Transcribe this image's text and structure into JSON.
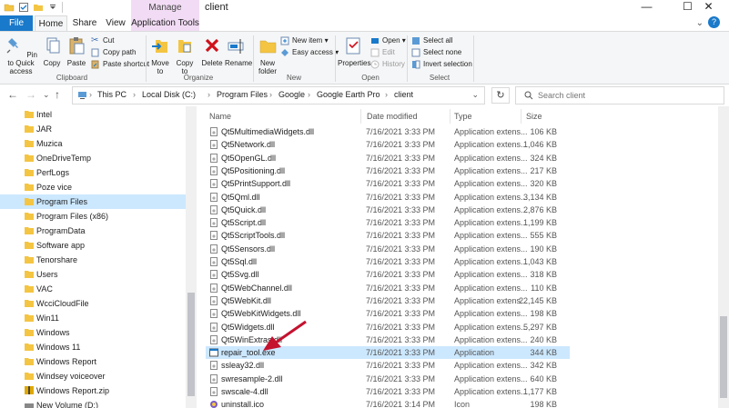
{
  "window": {
    "title": "client",
    "manage_label": "Manage",
    "minimize_glyph": "—",
    "maximize_glyph": "☐",
    "close_glyph": "✕"
  },
  "tabs": {
    "file": "File",
    "home": "Home",
    "share": "Share",
    "view": "View",
    "app_tools": "Application Tools"
  },
  "ribbon": {
    "clipboard": {
      "group": "Clipboard",
      "pin": "Pin to Quick access",
      "copy": "Copy",
      "paste": "Paste",
      "cut": "Cut",
      "copy_path": "Copy path",
      "paste_shortcut": "Paste shortcut"
    },
    "organize": {
      "group": "Organize",
      "move_to": "Move to",
      "copy_to": "Copy to",
      "delete": "Delete",
      "rename": "Rename"
    },
    "new": {
      "group": "New",
      "new_folder": "New folder",
      "new_item": "New item",
      "easy_access": "Easy access"
    },
    "open": {
      "group": "Open",
      "properties": "Properties",
      "open": "Open",
      "edit": "Edit",
      "history": "History"
    },
    "select": {
      "group": "Select",
      "select_all": "Select all",
      "select_none": "Select none",
      "invert": "Invert selection"
    }
  },
  "address": {
    "crumbs": [
      "This PC",
      "Local Disk (C:)",
      "Program Files",
      "Google",
      "Google Earth Pro",
      "client"
    ],
    "separator": "›",
    "search_placeholder": "Search client"
  },
  "nav": {
    "items": [
      {
        "label": "Intel",
        "selected": false
      },
      {
        "label": "JAR",
        "selected": false
      },
      {
        "label": "Muzica",
        "selected": false
      },
      {
        "label": "OneDriveTemp",
        "selected": false
      },
      {
        "label": "PerfLogs",
        "selected": false
      },
      {
        "label": "Poze vice",
        "selected": false
      },
      {
        "label": "Program Files",
        "selected": true
      },
      {
        "label": "Program Files (x86)",
        "selected": false
      },
      {
        "label": "ProgramData",
        "selected": false
      },
      {
        "label": "Software app",
        "selected": false
      },
      {
        "label": "Tenorshare",
        "selected": false
      },
      {
        "label": "Users",
        "selected": false
      },
      {
        "label": "VAC",
        "selected": false
      },
      {
        "label": "WcciCloudFile",
        "selected": false
      },
      {
        "label": "Win11",
        "selected": false
      },
      {
        "label": "Windows",
        "selected": false
      },
      {
        "label": "Windows 11",
        "selected": false
      },
      {
        "label": "Windows Report",
        "selected": false
      },
      {
        "label": "Windsey voiceover",
        "selected": false
      },
      {
        "label": "Windows Report.zip",
        "selected": false
      },
      {
        "label": "New Volume (D:)",
        "selected": false
      }
    ]
  },
  "columns": {
    "name": "Name",
    "date": "Date modified",
    "type": "Type",
    "size": "Size"
  },
  "files": [
    {
      "name": "Qt5MultimediaWidgets.dll",
      "date": "7/16/2021 3:33 PM",
      "type": "Application extens...",
      "size": "106 KB",
      "kind": "dll"
    },
    {
      "name": "Qt5Network.dll",
      "date": "7/16/2021 3:33 PM",
      "type": "Application extens...",
      "size": "1,046 KB",
      "kind": "dll"
    },
    {
      "name": "Qt5OpenGL.dll",
      "date": "7/16/2021 3:33 PM",
      "type": "Application extens...",
      "size": "324 KB",
      "kind": "dll"
    },
    {
      "name": "Qt5Positioning.dll",
      "date": "7/16/2021 3:33 PM",
      "type": "Application extens...",
      "size": "217 KB",
      "kind": "dll"
    },
    {
      "name": "Qt5PrintSupport.dll",
      "date": "7/16/2021 3:33 PM",
      "type": "Application extens...",
      "size": "320 KB",
      "kind": "dll"
    },
    {
      "name": "Qt5Qml.dll",
      "date": "7/16/2021 3:33 PM",
      "type": "Application extens...",
      "size": "3,134 KB",
      "kind": "dll"
    },
    {
      "name": "Qt5Quick.dll",
      "date": "7/16/2021 3:33 PM",
      "type": "Application extens...",
      "size": "2,876 KB",
      "kind": "dll"
    },
    {
      "name": "Qt5Script.dll",
      "date": "7/16/2021 3:33 PM",
      "type": "Application extens...",
      "size": "1,199 KB",
      "kind": "dll"
    },
    {
      "name": "Qt5ScriptTools.dll",
      "date": "7/16/2021 3:33 PM",
      "type": "Application extens...",
      "size": "555 KB",
      "kind": "dll"
    },
    {
      "name": "Qt5Sensors.dll",
      "date": "7/16/2021 3:33 PM",
      "type": "Application extens...",
      "size": "190 KB",
      "kind": "dll"
    },
    {
      "name": "Qt5Sql.dll",
      "date": "7/16/2021 3:33 PM",
      "type": "Application extens...",
      "size": "1,043 KB",
      "kind": "dll"
    },
    {
      "name": "Qt5Svg.dll",
      "date": "7/16/2021 3:33 PM",
      "type": "Application extens...",
      "size": "318 KB",
      "kind": "dll"
    },
    {
      "name": "Qt5WebChannel.dll",
      "date": "7/16/2021 3:33 PM",
      "type": "Application extens...",
      "size": "110 KB",
      "kind": "dll"
    },
    {
      "name": "Qt5WebKit.dll",
      "date": "7/16/2021 3:33 PM",
      "type": "Application extens...",
      "size": "22,145 KB",
      "kind": "dll"
    },
    {
      "name": "Qt5WebKitWidgets.dll",
      "date": "7/16/2021 3:33 PM",
      "type": "Application extens...",
      "size": "198 KB",
      "kind": "dll"
    },
    {
      "name": "Qt5Widgets.dll",
      "date": "7/16/2021 3:33 PM",
      "type": "Application extens...",
      "size": "5,297 KB",
      "kind": "dll"
    },
    {
      "name": "Qt5WinExtras.dll",
      "date": "7/16/2021 3:33 PM",
      "type": "Application extens...",
      "size": "240 KB",
      "kind": "dll"
    },
    {
      "name": "repair_tool.exe",
      "date": "7/16/2021 3:33 PM",
      "type": "Application",
      "size": "344 KB",
      "kind": "exe",
      "selected": true
    },
    {
      "name": "ssleay32.dll",
      "date": "7/16/2021 3:33 PM",
      "type": "Application extens...",
      "size": "342 KB",
      "kind": "dll"
    },
    {
      "name": "swresample-2.dll",
      "date": "7/16/2021 3:33 PM",
      "type": "Application extens...",
      "size": "640 KB",
      "kind": "dll"
    },
    {
      "name": "swscale-4.dll",
      "date": "7/16/2021 3:33 PM",
      "type": "Application extens...",
      "size": "1,177 KB",
      "kind": "dll"
    },
    {
      "name": "uninstall.ico",
      "date": "7/16/2021 3:14 PM",
      "type": "Icon",
      "size": "198 KB",
      "kind": "ico"
    }
  ],
  "colors": {
    "accent": "#1979ca",
    "manage": "#f2dcf5",
    "selection": "#cce8ff",
    "folder": "#f4c542",
    "arrow": "#c4122f"
  }
}
